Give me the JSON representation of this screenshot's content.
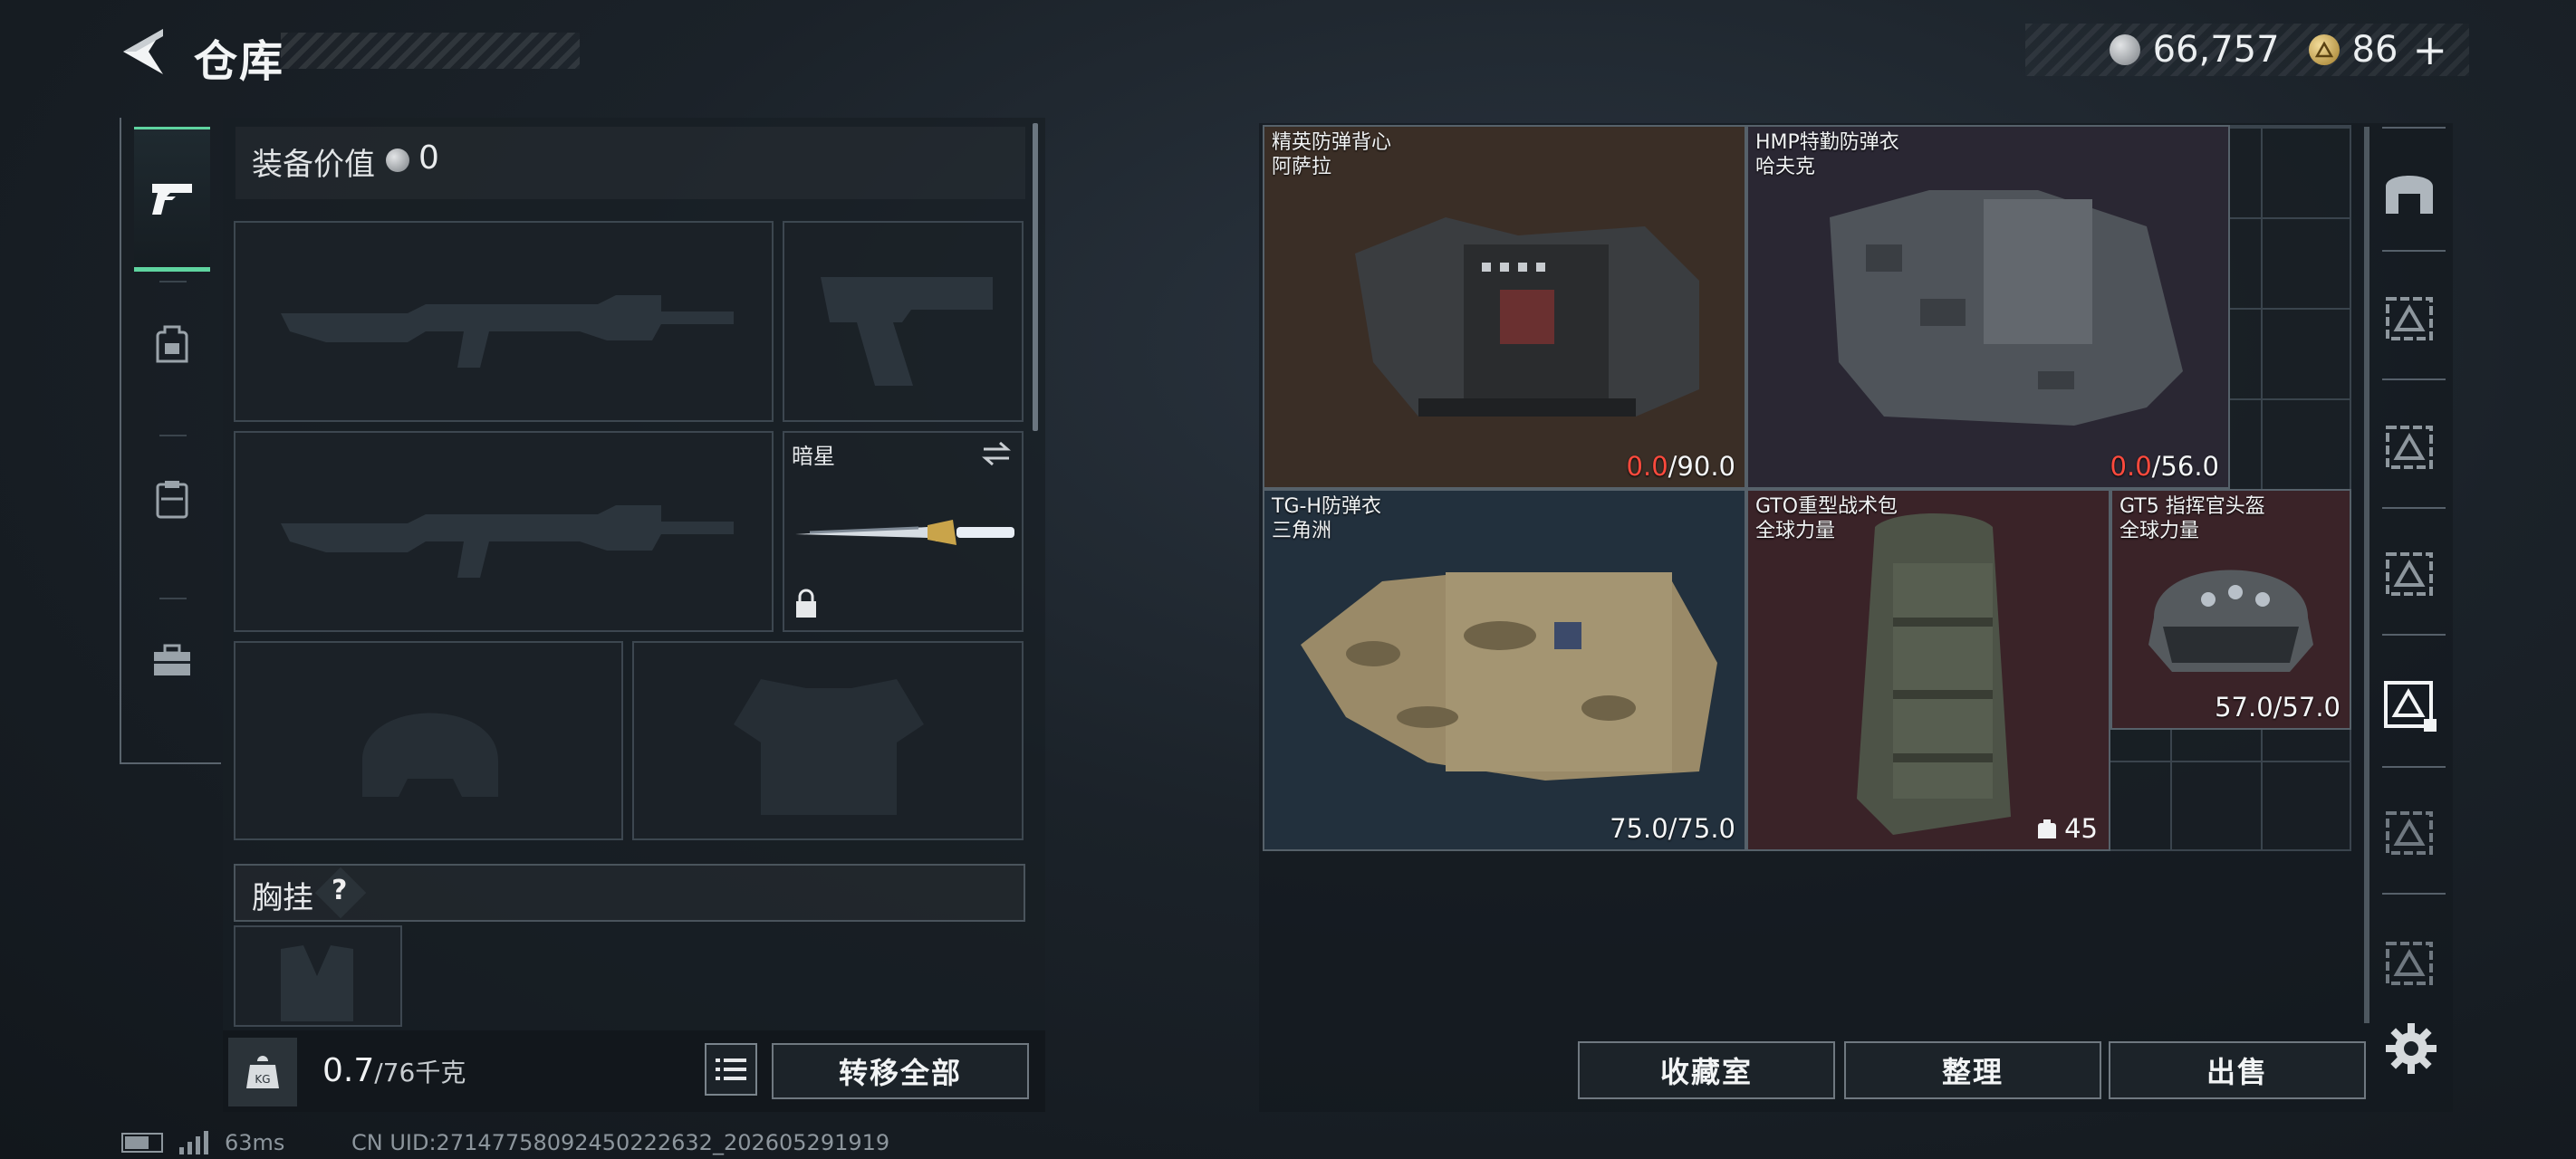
{
  "header": {
    "title": "仓库",
    "currencies": [
      {
        "icon": "silver-coin-icon",
        "value": "66,757"
      },
      {
        "icon": "gold-coin-icon",
        "value": "86"
      }
    ],
    "plus_label": "+"
  },
  "nav": {
    "items": [
      {
        "icon": "pistol-icon",
        "active": true
      },
      {
        "icon": "backpack-icon",
        "active": false
      },
      {
        "icon": "chest-rig-icon",
        "active": false
      },
      {
        "icon": "toolbox-icon",
        "active": false
      }
    ]
  },
  "equipment": {
    "value_label": "装备价值",
    "value": "0",
    "slots": [
      {
        "type": "primary-weapon",
        "empty": true
      },
      {
        "type": "pistol",
        "empty": true
      },
      {
        "type": "secondary-weapon",
        "empty": true
      },
      {
        "type": "melee",
        "label": "暗星",
        "locked": true
      },
      {
        "type": "helmet",
        "empty": true
      },
      {
        "type": "armor",
        "empty": true
      }
    ],
    "chest_label": "胸挂",
    "chest_help": "?",
    "weight_value": "0.7",
    "weight_max": "/76千克",
    "transfer_label": "转移全部"
  },
  "stash": {
    "items": [
      {
        "name": "精英防弹背心\n阿萨拉",
        "durability_current": "0.0",
        "durability_max": "/90.0",
        "bg": "#3a2e26"
      },
      {
        "name": "HMP特勤防弹衣\n哈夫克",
        "durability_current": "0.0",
        "durability_max": "/56.0",
        "bg": "#2a2733"
      },
      {
        "name": "TG-H防弹衣\n三角洲",
        "durability": "75.0/75.0",
        "bg": "#22303d"
      },
      {
        "name": "GTO重型战术包\n全球力量",
        "count": "45",
        "bg": "#3a2328"
      },
      {
        "name": "GT5 指挥官头盔\n全球力量",
        "durability": "57.0/57.0",
        "bg": "#3a2328"
      }
    ],
    "buttons": [
      "收藏室",
      "整理",
      "出售"
    ]
  },
  "rail": {
    "items": [
      "storage-icon",
      "container-icon",
      "container-icon",
      "container-icon",
      "container-icon",
      "container-icon",
      "container-icon"
    ]
  },
  "status": {
    "ping": "63ms",
    "uid": "CN UID:27147758092450222632_202605291919"
  }
}
